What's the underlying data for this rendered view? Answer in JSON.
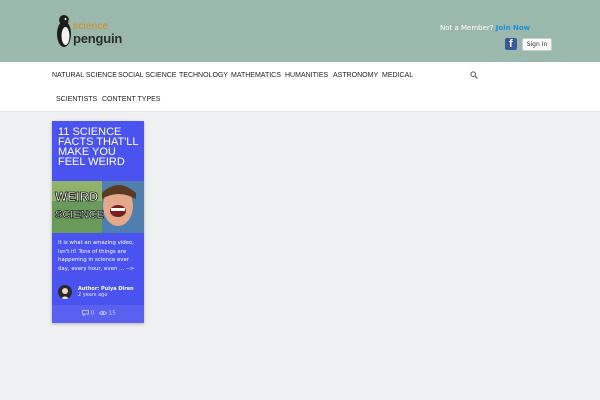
{
  "header": {
    "logo_word1": "science",
    "logo_word2": "penguin",
    "member_text": "Not a Member?",
    "join_link": "Join Now",
    "facebook_glyph": "f",
    "signin_label": "Sign In"
  },
  "nav": {
    "items": [
      "NATURAL SCIENCE",
      "SOCIAL SCIENCE",
      "TECHNOLOGY",
      "MATHEMATICS",
      "HUMANITIES",
      "ASTRONOMY",
      "MEDICAL",
      "SCIENTISTS",
      "CONTENT TYPES"
    ],
    "search_icon": "search-icon"
  },
  "post": {
    "title": "11 Science Facts That'll Make You Feel Weird",
    "image_text_line1": "WEIRD",
    "image_text_line2": "SCIENCE",
    "excerpt": "It is what an amazing video, isn't it! Tons of things are happening in science ever day, every hour, even ... -->",
    "author": "Author: Pulya Diren",
    "time": "2 years ago",
    "comments": "0",
    "views": "15"
  },
  "colors": {
    "header_bg": "#9bb8ad",
    "card_bg": "#4a52f0",
    "accent_link": "#1a8fd4",
    "logo_orange": "#d98a1d"
  }
}
